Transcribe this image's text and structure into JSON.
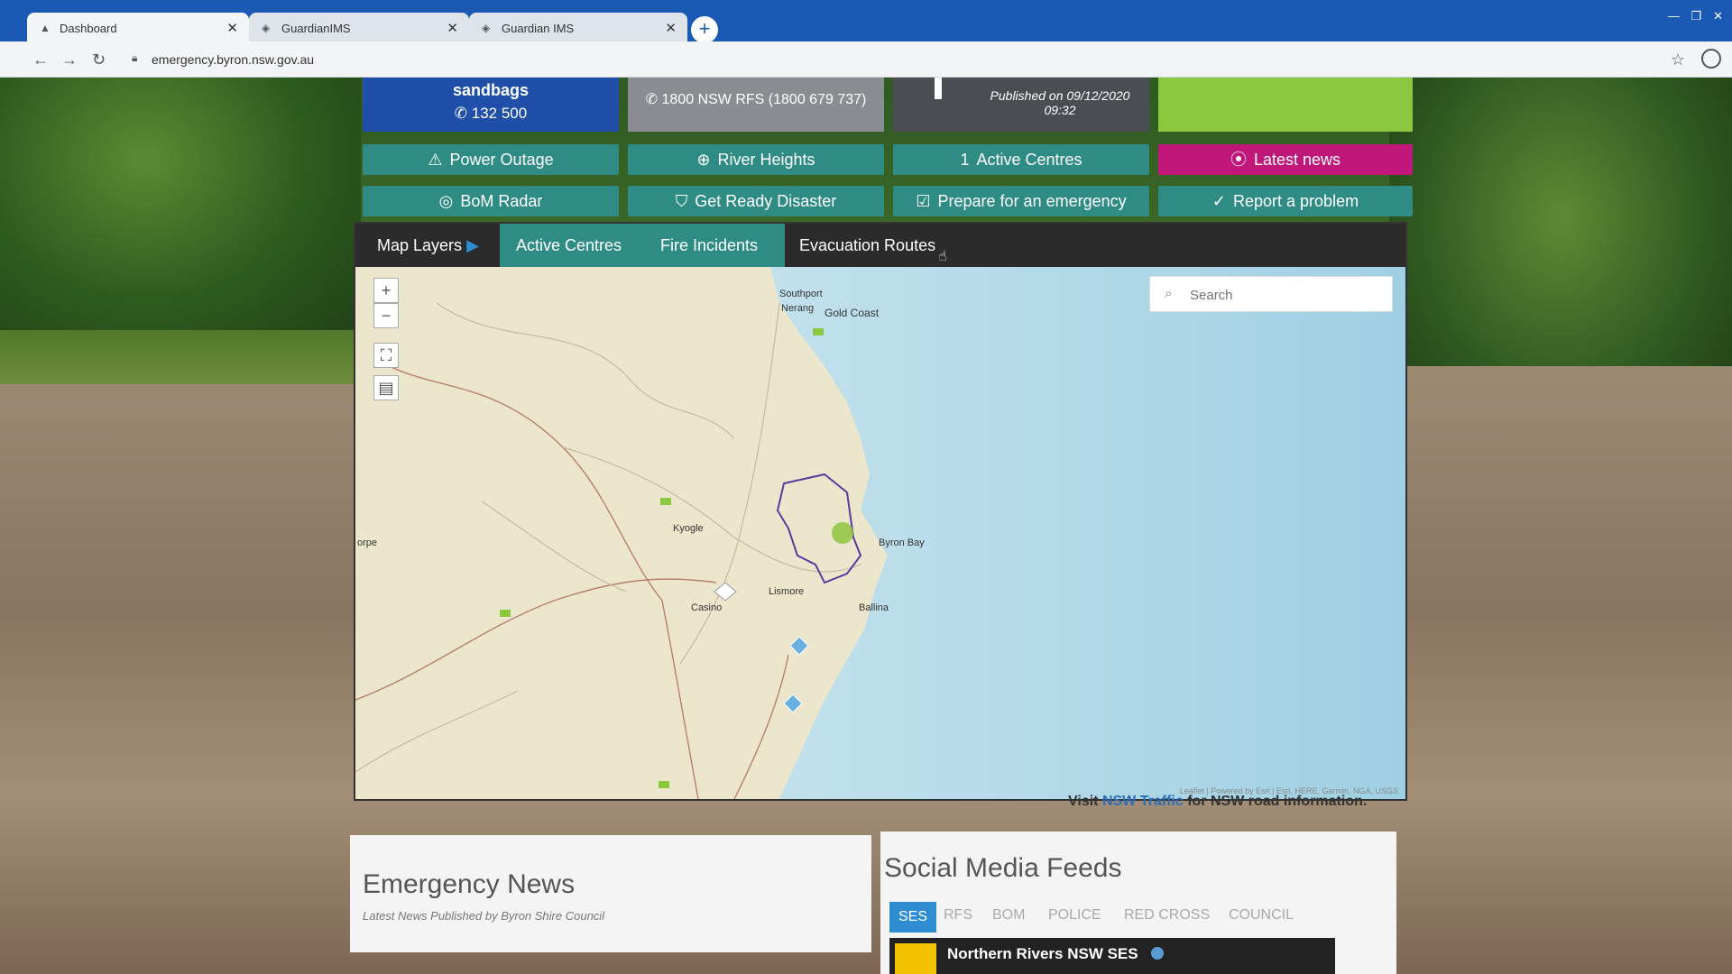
{
  "browser": {
    "tabs": [
      {
        "title": "Dashboard",
        "active": true
      },
      {
        "title": "GuardianIMS",
        "active": false
      },
      {
        "title": "Guardian IMS",
        "active": false
      }
    ],
    "url": "emergency.byron.nsw.gov.au"
  },
  "top_cards": {
    "sandbags_label": "sandbags",
    "sandbags_phone": "132 500",
    "rfs_phone": "1800 NSW RFS (1800 679 737)",
    "published": "Published on 09/12/2020 09:32"
  },
  "buttons": {
    "power_outage": "Power Outage",
    "river_heights": "River Heights",
    "active_centres_count": "1",
    "active_centres": "Active Centres",
    "latest_news": "Latest news",
    "bom_radar": "BoM Radar",
    "get_ready": "Get Ready Disaster",
    "prepare": "Prepare for an emergency",
    "report": "Report a problem"
  },
  "map": {
    "tabs": {
      "map_layers": "Map Layers",
      "active_centres": "Active Centres",
      "fire_incidents": "Fire Incidents",
      "evacuation_routes": "Evacuation Routes"
    },
    "search_placeholder": "Search",
    "places": {
      "southport": "Southport",
      "nerang": "Nerang",
      "gold_coast": "Gold Coast",
      "kyogle": "Kyogle",
      "byron_bay": "Byron Bay",
      "lismore": "Lismore",
      "casino": "Casino",
      "ballina": "Ballina",
      "grafton": "orpe"
    },
    "attribution": "Leaflet | Powered by Esri | Esri, HERE, Garmin, NGA, USGS"
  },
  "road_info": {
    "prefix": "Visit",
    "link": "NSW Traffic",
    "suffix": "for NSW road information."
  },
  "news": {
    "title": "Emergency News",
    "subtitle": "Latest News Published by Byron Shire Council"
  },
  "social": {
    "title": "Social Media Feeds",
    "tabs": [
      "SES",
      "RFS",
      "BOM",
      "POLICE",
      "RED CROSS",
      "COUNCIL"
    ],
    "feed_name": "Northern Rivers NSW SES"
  },
  "colors": {
    "teal": "#2e8c84",
    "magenta": "#c0187a",
    "navy": "#1f4fa8",
    "lime": "#8dc63f",
    "chrome_blue": "#1a5ab4"
  }
}
